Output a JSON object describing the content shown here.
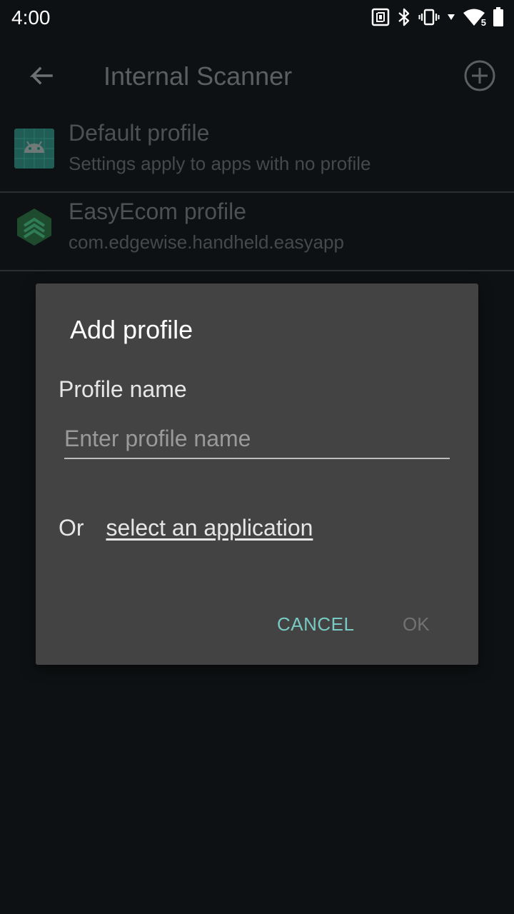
{
  "status_bar": {
    "time": "4:00",
    "icons": [
      "nfc-icon",
      "bluetooth-icon",
      "vibrate-icon",
      "data-arrow-icon",
      "wifi-icon",
      "battery-icon"
    ],
    "wifi_badge": "5"
  },
  "app_bar": {
    "title": "Internal Scanner",
    "back_icon": "arrow-back-icon",
    "add_icon": "add-circle-icon"
  },
  "profiles": [
    {
      "title": "Default profile",
      "subtitle": "Settings apply to apps with no profile",
      "icon": "android-icon"
    },
    {
      "title": "EasyEcom profile",
      "subtitle": "com.edgewise.handheld.easyapp",
      "icon": "easyecom-logo-icon"
    }
  ],
  "dialog": {
    "title": "Add profile",
    "field_label": "Profile name",
    "input_value": "",
    "input_placeholder": "Enter profile name",
    "or_text": "Or",
    "select_app_link": "select an application",
    "cancel_label": "CANCEL",
    "ok_label": "OK"
  },
  "colors": {
    "background": "#0e1113",
    "dialog_background": "#434343",
    "accent": "#79c9c3",
    "disabled": "#727272"
  }
}
